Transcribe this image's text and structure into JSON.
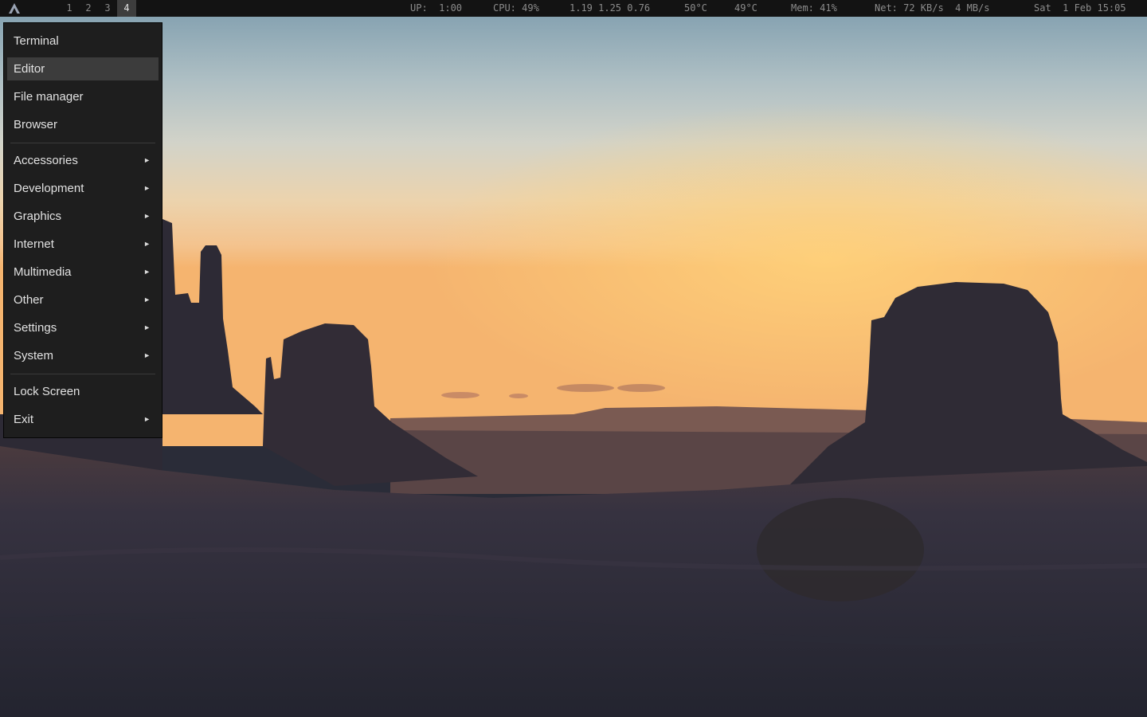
{
  "topbar": {
    "workspaces": [
      "1",
      "2",
      "3",
      "4"
    ],
    "active_workspace": "4",
    "uptime": "UP:  1:00",
    "cpu": "CPU: 49%",
    "load": "1.19 1.25 0.76",
    "temp1": "50°C",
    "temp2": "49°C",
    "mem": "Mem: 41%",
    "net": "Net: 72 KB/s  4 MB/s",
    "date": "Sat  1 Feb 15:05"
  },
  "menu": {
    "items": [
      {
        "label": "Terminal",
        "submenu": false
      },
      {
        "label": "Editor",
        "submenu": false,
        "selected": true
      },
      {
        "label": "File manager",
        "submenu": false
      },
      {
        "label": "Browser",
        "submenu": false
      },
      {
        "label": "Accessories",
        "submenu": true
      },
      {
        "label": "Development",
        "submenu": true
      },
      {
        "label": "Graphics",
        "submenu": true
      },
      {
        "label": "Internet",
        "submenu": true
      },
      {
        "label": "Multimedia",
        "submenu": true
      },
      {
        "label": "Other",
        "submenu": true
      },
      {
        "label": "Settings",
        "submenu": true
      },
      {
        "label": "System",
        "submenu": true
      },
      {
        "label": "Lock Screen",
        "submenu": false
      },
      {
        "label": "Exit",
        "submenu": true
      }
    ],
    "submenu_arrow": "►"
  },
  "icons": {
    "logo": "archlabs-logo-icon",
    "submenu": "triangle-right-icon"
  },
  "colors": {
    "bar_bg": "#131313",
    "menu_bg": "#1e1e1e",
    "menu_selected": "#3c3c3c",
    "text": "#e2e2e2"
  }
}
